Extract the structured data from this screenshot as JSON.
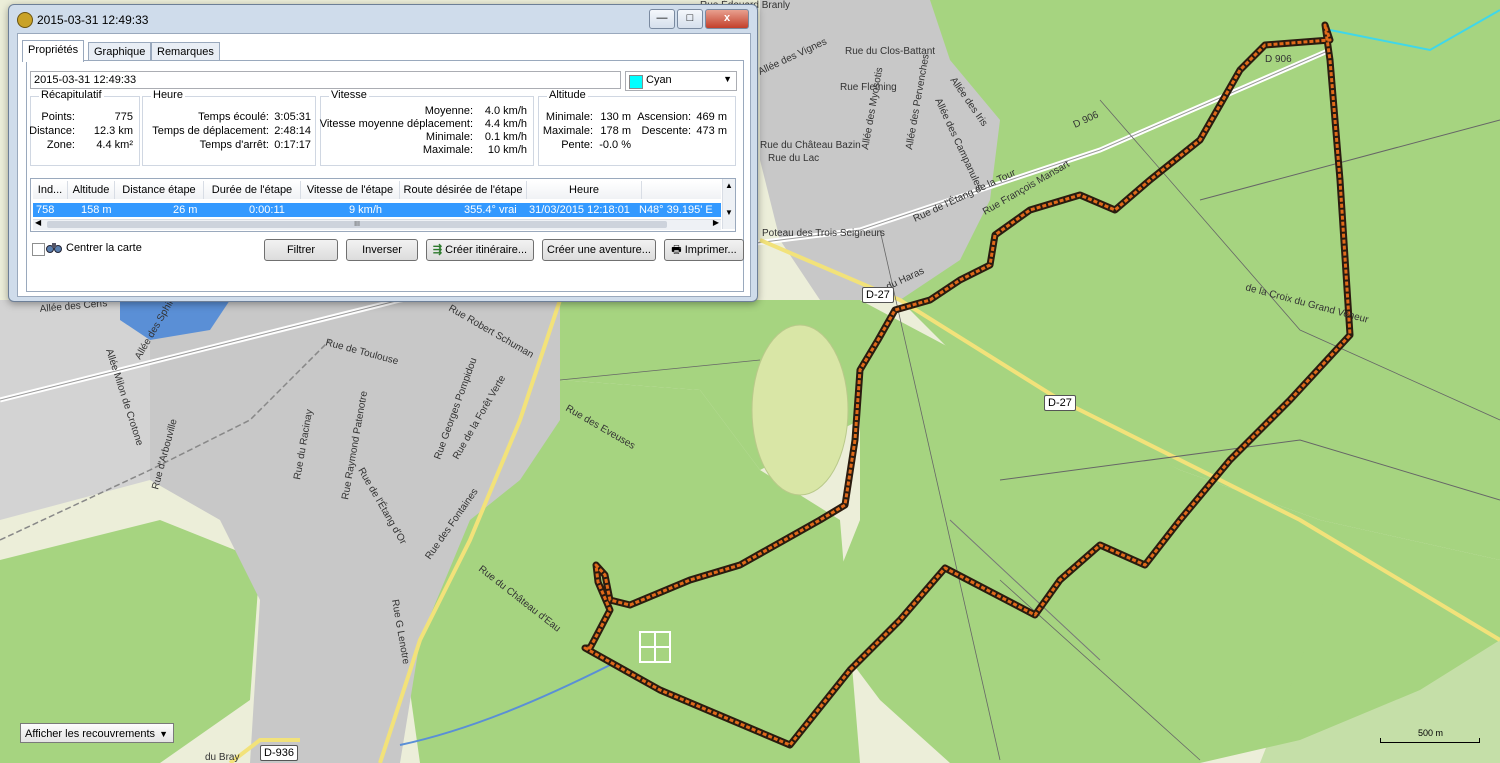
{
  "window": {
    "title": "2015-03-31 12:49:33",
    "minimize_label": "—",
    "maximize_label": "□",
    "close_label": "x"
  },
  "tabs": [
    {
      "label": "Propriétés"
    },
    {
      "label": "Graphique"
    },
    {
      "label": "Remarques"
    }
  ],
  "track": {
    "name": "2015-03-31 12:49:33",
    "color": {
      "label": "Cyan",
      "hex": "#00ffff"
    }
  },
  "summary": {
    "title": "Récapitulatif",
    "points_label": "Points:",
    "points_value": "775",
    "distance_label": "Distance:",
    "distance_value": "12.3 km",
    "zone_label": "Zone:",
    "zone_value": "4.4 km²"
  },
  "time": {
    "title": "Heure",
    "elapsed_label": "Temps écoulé:",
    "elapsed_value": "3:05:31",
    "moving_label": "Temps de déplacement:",
    "moving_value": "2:48:14",
    "stopped_label": "Temps d'arrêt:",
    "stopped_value": "0:17:17"
  },
  "speed": {
    "title": "Vitesse",
    "avg_label": "Moyenne:",
    "avg_value": "4.0 km/h",
    "avg_moving_label": "Vitesse moyenne déplacement:",
    "avg_moving_value": "4.4 km/h",
    "min_label": "Minimale:",
    "min_value": "0.1 km/h",
    "max_label": "Maximale:",
    "max_value": "10 km/h"
  },
  "altitude": {
    "title": "Altitude",
    "min_label": "Minimale:",
    "min_value": "130 m",
    "max_label": "Maximale:",
    "max_value": "178 m",
    "slope_label": "Pente:",
    "slope_value": "-0.0 %",
    "ascent_label": "Ascension:",
    "ascent_value": "469 m",
    "descent_label": "Descente:",
    "descent_value": "473 m"
  },
  "table": {
    "columns": [
      "Ind...",
      "Altitude",
      "Distance étape",
      "Durée de l'étape",
      "Vitesse de l'étape",
      "Route désirée de l'étape",
      "Heure"
    ],
    "selected_row": {
      "index": "758",
      "altitude": "158 m",
      "leg_distance": "26 m",
      "leg_duration": "0:00:11",
      "leg_speed": "9 km/h",
      "leg_course": "355.4° vrai",
      "time": "31/03/2015 12:18:01",
      "position": "N48° 39.195' E"
    },
    "scroll_thumb": "III"
  },
  "actions": {
    "center_map_label": "Centrer la carte",
    "filter_label": "Filtrer",
    "invert_label": "Inverser",
    "create_route_label": "Créer itinéraire...",
    "create_adventure_label": "Créer une aventure...",
    "print_label": "Imprimer..."
  },
  "map": {
    "overlay_select_label": "Afficher les recouvrements",
    "scale_label": "500 m",
    "road_shields": [
      "D-27",
      "D-27",
      "D-936"
    ],
    "street_labels": [
      "Rue du Clos-Battant",
      "Allée des Vignes",
      "Rue Fleming",
      "Allée des Campanules",
      "Allée des Iris",
      "Rue du Château Bazin",
      "Rue du Lac",
      "Allée des Myosotis",
      "Allée des Pervenches",
      "Rue de l'Étang de la Tour",
      "Rue François Mansart",
      "D 906",
      "D 906",
      "Poteau des Trois Seigneurs",
      "du Haras",
      "de la Croix du Grand Veneur",
      "Rue de Toulouse",
      "Rue Robert Schuman",
      "Rue des Eveuses",
      "Rue Georges Pompidou",
      "Rue de la Forêt Verte",
      "Rue du Racinay",
      "Rue Raymond Patenotre",
      "Rue de l'Étang d'Or",
      "Rue des Fontaines",
      "Rue G Lenotre",
      "Rue du Château d'Eau",
      "Rue d'Arbouville",
      "Allée Milon de Crotone",
      "Allée des Sphinx",
      "Allée des Cerfs",
      "du Bray",
      "Rue Édouard Branly"
    ]
  },
  "colors": {
    "forest": "#a6d480",
    "open": "#eceed9",
    "urban": "#c8c8c8",
    "track_outer": "#2a1b0f",
    "track_inner": "#e06a1a",
    "water": "#5a8fd6",
    "main_road": "#f2e27a"
  }
}
